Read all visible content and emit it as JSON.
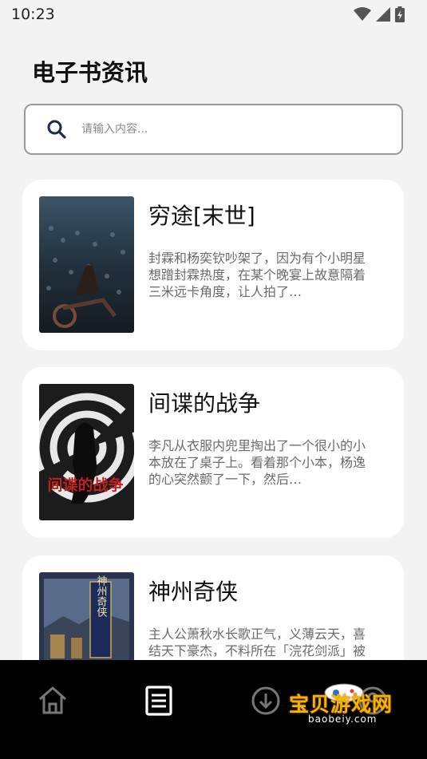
{
  "status_bar": {
    "time": "10:23"
  },
  "page_title": "电子书资讯",
  "search": {
    "placeholder": "请输入内容..."
  },
  "books": [
    {
      "title": "穷途[末世]",
      "description": "封霖和杨奕钦吵架了，因为有个小明星想蹭封霖热度，在某个晚宴上故意隔着三米远卡角度，让人拍了…"
    },
    {
      "title": "间谍的战争",
      "description": "李凡从衣服内兜里掏出了一个很小的小本放在了桌子上。看着那个小本，杨逸的心突然颤了一下，然后…"
    },
    {
      "title": "神州奇侠",
      "description": "主人公萧秋水长歌正气，义薄云天，喜结天下豪杰，不料所在「浣花剑派」被权力帮所灭…"
    }
  ],
  "covers": [
    {
      "art_text": ""
    },
    {
      "art_text": "间谍的战争"
    },
    {
      "art_text": "神州奇侠"
    }
  ],
  "bottom_nav": {
    "items": [
      {
        "icon": "home-icon",
        "active": false
      },
      {
        "icon": "list-icon",
        "active": true
      },
      {
        "icon": "download-icon",
        "active": false
      },
      {
        "icon": "profile-icon",
        "active": false
      }
    ]
  },
  "watermark": {
    "text": "宝贝游戏网",
    "url": "baobeiy.com"
  },
  "colors": {
    "background": "#f3f3f3",
    "card": "#ffffff",
    "nav": "#000000",
    "search_icon": "#1f2a44"
  }
}
